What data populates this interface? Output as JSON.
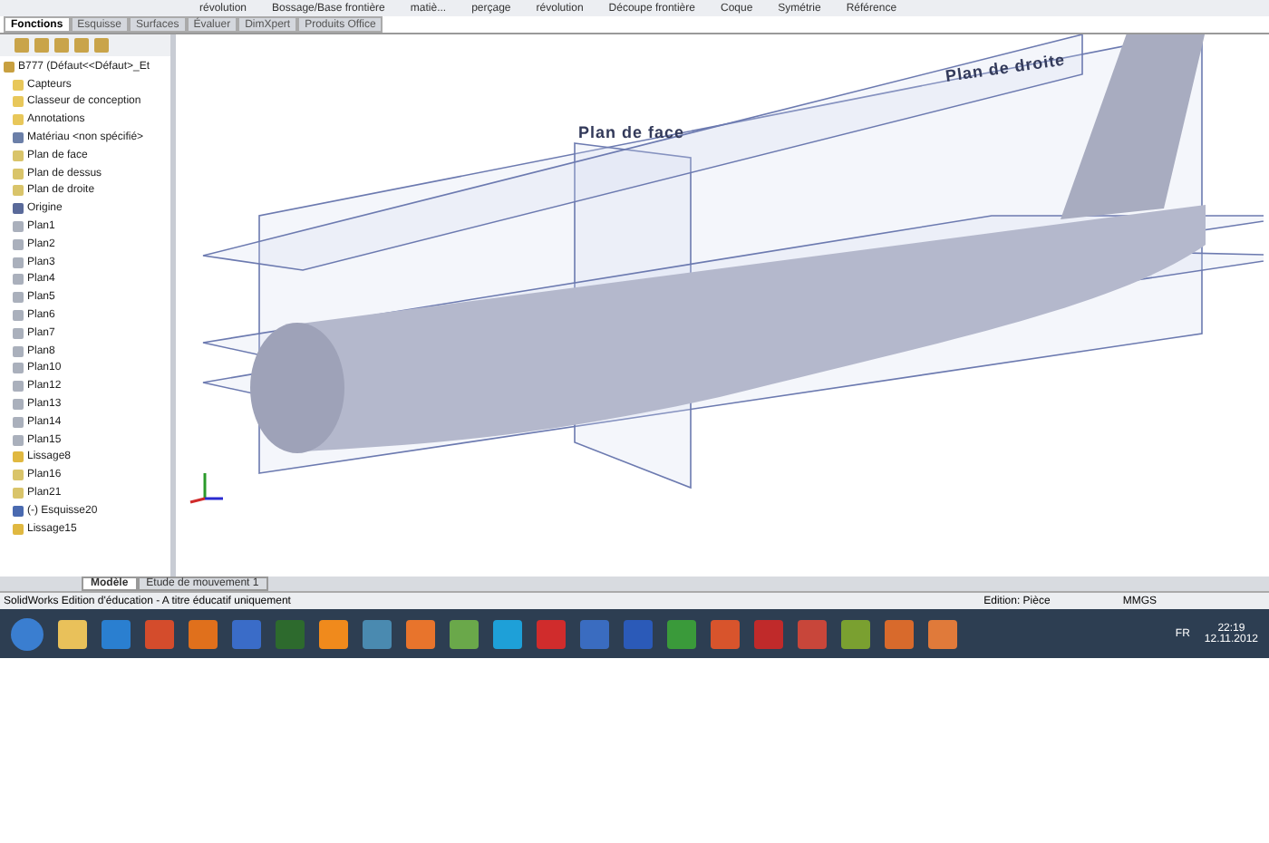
{
  "ribbon": {
    "commands": [
      "révolution",
      "Bossage/Base frontière",
      "matiè...",
      "perçage",
      "révolution",
      "Découpe frontière",
      "Coque",
      "Symétrie",
      "Référence"
    ]
  },
  "tabs": [
    {
      "label": "Fonctions",
      "selected": true
    },
    {
      "label": "Esquisse",
      "selected": false
    },
    {
      "label": "Surfaces",
      "selected": false
    },
    {
      "label": "Évaluer",
      "selected": false
    },
    {
      "label": "DimXpert",
      "selected": false
    },
    {
      "label": "Produits Office",
      "selected": false
    }
  ],
  "tree": {
    "root": {
      "label": "B777  (Défaut<<Défaut>_Et",
      "children": [
        {
          "label": "Capteurs",
          "kind": "folder"
        },
        {
          "label": "Classeur de conception",
          "kind": "folder"
        },
        {
          "label": "Annotations",
          "kind": "folder"
        },
        {
          "label": "Matériau <non spécifié>",
          "kind": "material"
        },
        {
          "label": "Plan de face",
          "kind": "plane"
        },
        {
          "label": "Plan de dessus",
          "kind": "plane"
        },
        {
          "label": "Plan de droite",
          "kind": "plane"
        },
        {
          "label": "Origine",
          "kind": "origin"
        },
        {
          "label": "Plan1",
          "kind": "refplane"
        },
        {
          "label": "Plan2",
          "kind": "refplane"
        },
        {
          "label": "Plan3",
          "kind": "refplane"
        },
        {
          "label": "Plan4",
          "kind": "refplane"
        },
        {
          "label": "Plan5",
          "kind": "refplane"
        },
        {
          "label": "Plan6",
          "kind": "refplane"
        },
        {
          "label": "Plan7",
          "kind": "refplane"
        },
        {
          "label": "Plan8",
          "kind": "refplane"
        },
        {
          "label": "Plan10",
          "kind": "refplane"
        },
        {
          "label": "Plan12",
          "kind": "refplane"
        },
        {
          "label": "Plan13",
          "kind": "refplane"
        },
        {
          "label": "Plan14",
          "kind": "refplane"
        },
        {
          "label": "Plan15",
          "kind": "refplane"
        },
        {
          "label": "Lissage8",
          "kind": "feature"
        },
        {
          "label": "Plan16",
          "kind": "plane"
        },
        {
          "label": "Plan21",
          "kind": "plane"
        },
        {
          "label": "(-) Esquisse20",
          "kind": "sketch"
        },
        {
          "label": "Lissage15",
          "kind": "feature"
        }
      ]
    }
  },
  "viewport": {
    "plane_labels": [
      "Plan de face",
      "Plan de droite"
    ]
  },
  "bottom_tabs": [
    {
      "label": "Modèle",
      "selected": true
    },
    {
      "label": "Etude de mouvement 1",
      "selected": false
    }
  ],
  "status_bar": {
    "message": "SolidWorks Edition d'éducation - A titre éducatif uniquement",
    "mode": "Edition: Pièce",
    "units": "MMGS"
  },
  "taskbar": {
    "language": "FR",
    "time": "22:19",
    "date": "12.11.2012"
  }
}
